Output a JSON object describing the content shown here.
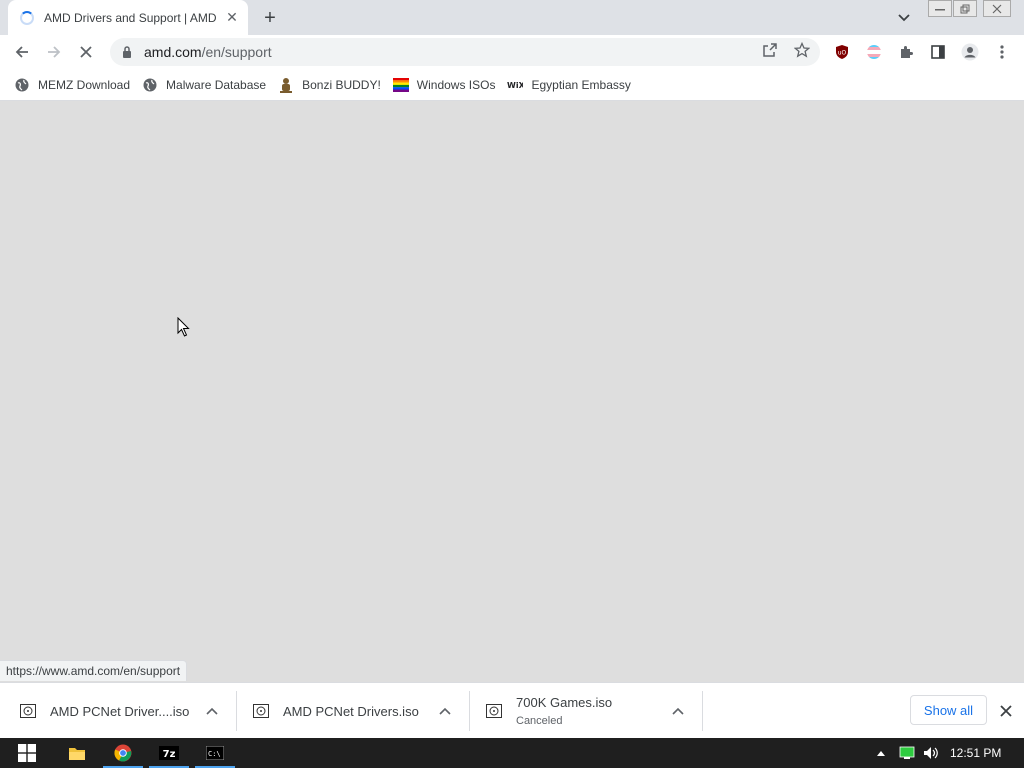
{
  "tab": {
    "title": "AMD Drivers and Support | AMD"
  },
  "toolbar": {
    "url_host": "amd.com",
    "url_path": "/en/support"
  },
  "bookmarks": [
    {
      "label": "MEMZ Download",
      "icon": "globe-icon"
    },
    {
      "label": "Malware Database",
      "icon": "globe-icon"
    },
    {
      "label": "Bonzi BUDDY!",
      "icon": "bonzi-icon"
    },
    {
      "label": "Windows ISOs",
      "icon": "rainbow-flag-icon"
    },
    {
      "label": "Egyptian Embassy",
      "icon": "wix-icon"
    }
  ],
  "status_url": "https://www.amd.com/en/support",
  "downloads": [
    {
      "name": "AMD PCNet Driver....iso",
      "status": ""
    },
    {
      "name": "AMD PCNet Drivers.iso",
      "status": ""
    },
    {
      "name": "700K Games.iso",
      "status": "Canceled"
    }
  ],
  "shelf": {
    "show_all": "Show all"
  },
  "taskbar": {
    "time": "12:51 PM"
  },
  "colors": {
    "accent": "#1a73e8",
    "ublock": "#800000",
    "taskbar": "#1f1f1f"
  }
}
